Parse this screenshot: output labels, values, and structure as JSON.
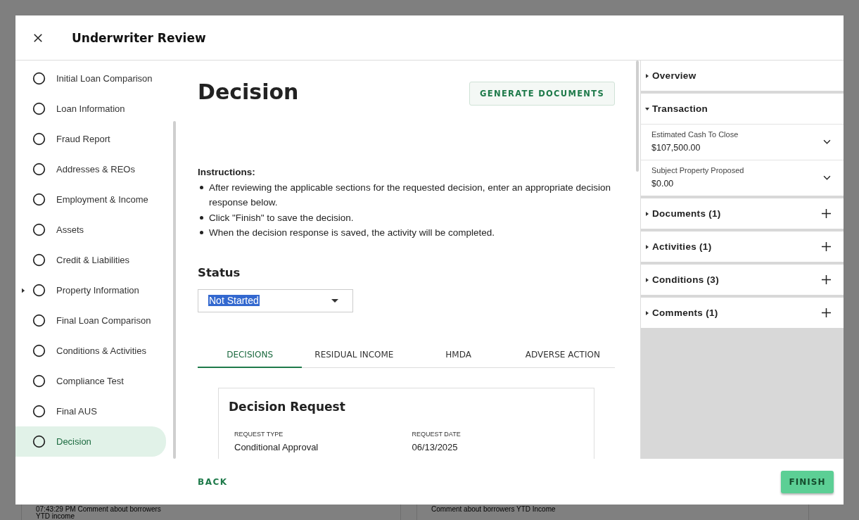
{
  "background": {
    "comments": [
      "07:43:29 PM Comment about borrowers YTD income",
      "Comment about borrowers YTD Income"
    ]
  },
  "modal": {
    "title": "Underwriter Review"
  },
  "sidebar": {
    "items": [
      {
        "label": "Initial Loan Comparison",
        "selected": false,
        "has_children": false
      },
      {
        "label": "Loan Information",
        "selected": false,
        "has_children": false
      },
      {
        "label": "Fraud Report",
        "selected": false,
        "has_children": false
      },
      {
        "label": "Addresses & REOs",
        "selected": false,
        "has_children": false
      },
      {
        "label": "Employment & Income",
        "selected": false,
        "has_children": false
      },
      {
        "label": "Assets",
        "selected": false,
        "has_children": false
      },
      {
        "label": "Credit & Liabilities",
        "selected": false,
        "has_children": false
      },
      {
        "label": "Property Information",
        "selected": false,
        "has_children": true
      },
      {
        "label": "Final Loan Comparison",
        "selected": false,
        "has_children": false
      },
      {
        "label": "Conditions & Activities",
        "selected": false,
        "has_children": false
      },
      {
        "label": "Compliance Test",
        "selected": false,
        "has_children": false
      },
      {
        "label": "Final AUS",
        "selected": false,
        "has_children": false
      },
      {
        "label": "Decision",
        "selected": true,
        "has_children": false
      }
    ]
  },
  "main": {
    "heading": "Decision",
    "generate_button": "GENERATE DOCUMENTS",
    "instructions": {
      "title": "Instructions:",
      "items": [
        "After reviewing the applicable sections for the requested decision, enter an appropriate decision response below.",
        "Click \"Finish\" to save the decision.",
        "When the decision response is saved, the activity will be completed."
      ]
    },
    "status": {
      "label": "Status",
      "value": "Not Started"
    },
    "tabs": [
      {
        "label": "DECISIONS",
        "selected": true
      },
      {
        "label": "RESIDUAL INCOME",
        "selected": false
      },
      {
        "label": "HMDA",
        "selected": false
      },
      {
        "label": "ADVERSE ACTION",
        "selected": false
      }
    ],
    "card": {
      "title": "Decision Request",
      "fields": [
        {
          "label": "REQUEST TYPE",
          "value": "Conditional Approval"
        },
        {
          "label": "REQUEST DATE",
          "value": "06/13/2025"
        }
      ]
    }
  },
  "right_panel": {
    "sections": [
      {
        "title": "Overview",
        "expanded": false,
        "addable": false
      },
      {
        "title": "Transaction",
        "expanded": true,
        "addable": false,
        "fields": [
          {
            "label": "Estimated Cash To Close",
            "value": "$107,500.00"
          },
          {
            "label": "Subject Property Proposed",
            "value": "$0.00"
          }
        ]
      },
      {
        "title": "Documents (1)",
        "expanded": false,
        "addable": true
      },
      {
        "title": "Activities (1)",
        "expanded": false,
        "addable": true
      },
      {
        "title": "Conditions (3)",
        "expanded": false,
        "addable": true
      },
      {
        "title": "Comments (1)",
        "expanded": false,
        "addable": true
      }
    ]
  },
  "footer": {
    "back": "BACK",
    "finish": "FINISH"
  }
}
